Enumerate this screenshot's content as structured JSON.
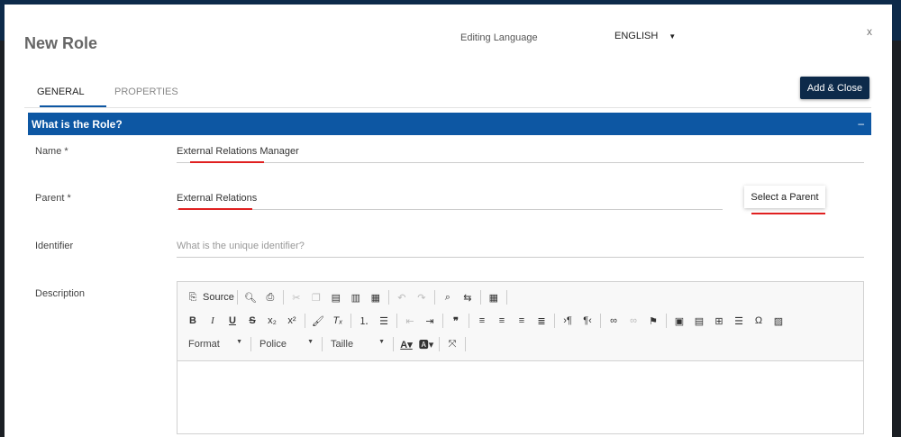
{
  "modal": {
    "title": "New Role",
    "editing_language_label": "Editing Language",
    "language": "ENGLISH",
    "close": "x"
  },
  "tabs": [
    {
      "label": "GENERAL"
    },
    {
      "label": "PROPERTIES"
    }
  ],
  "add_close": "Add & Close",
  "section": {
    "title": "What is the Role?",
    "collapse": "–"
  },
  "fields": {
    "name": {
      "label": "Name *",
      "value": "External Relations Manager"
    },
    "parent": {
      "label": "Parent  *",
      "value": "External Relations",
      "button": "Select a Parent"
    },
    "identifier": {
      "label": "Identifier",
      "placeholder": "What is the unique identifier?"
    },
    "description": {
      "label": "Description"
    }
  },
  "toolbar": {
    "source": "Source",
    "format": "Format",
    "font": "Police",
    "size": "Taille",
    "undo": "↶",
    "redo": "↷"
  }
}
